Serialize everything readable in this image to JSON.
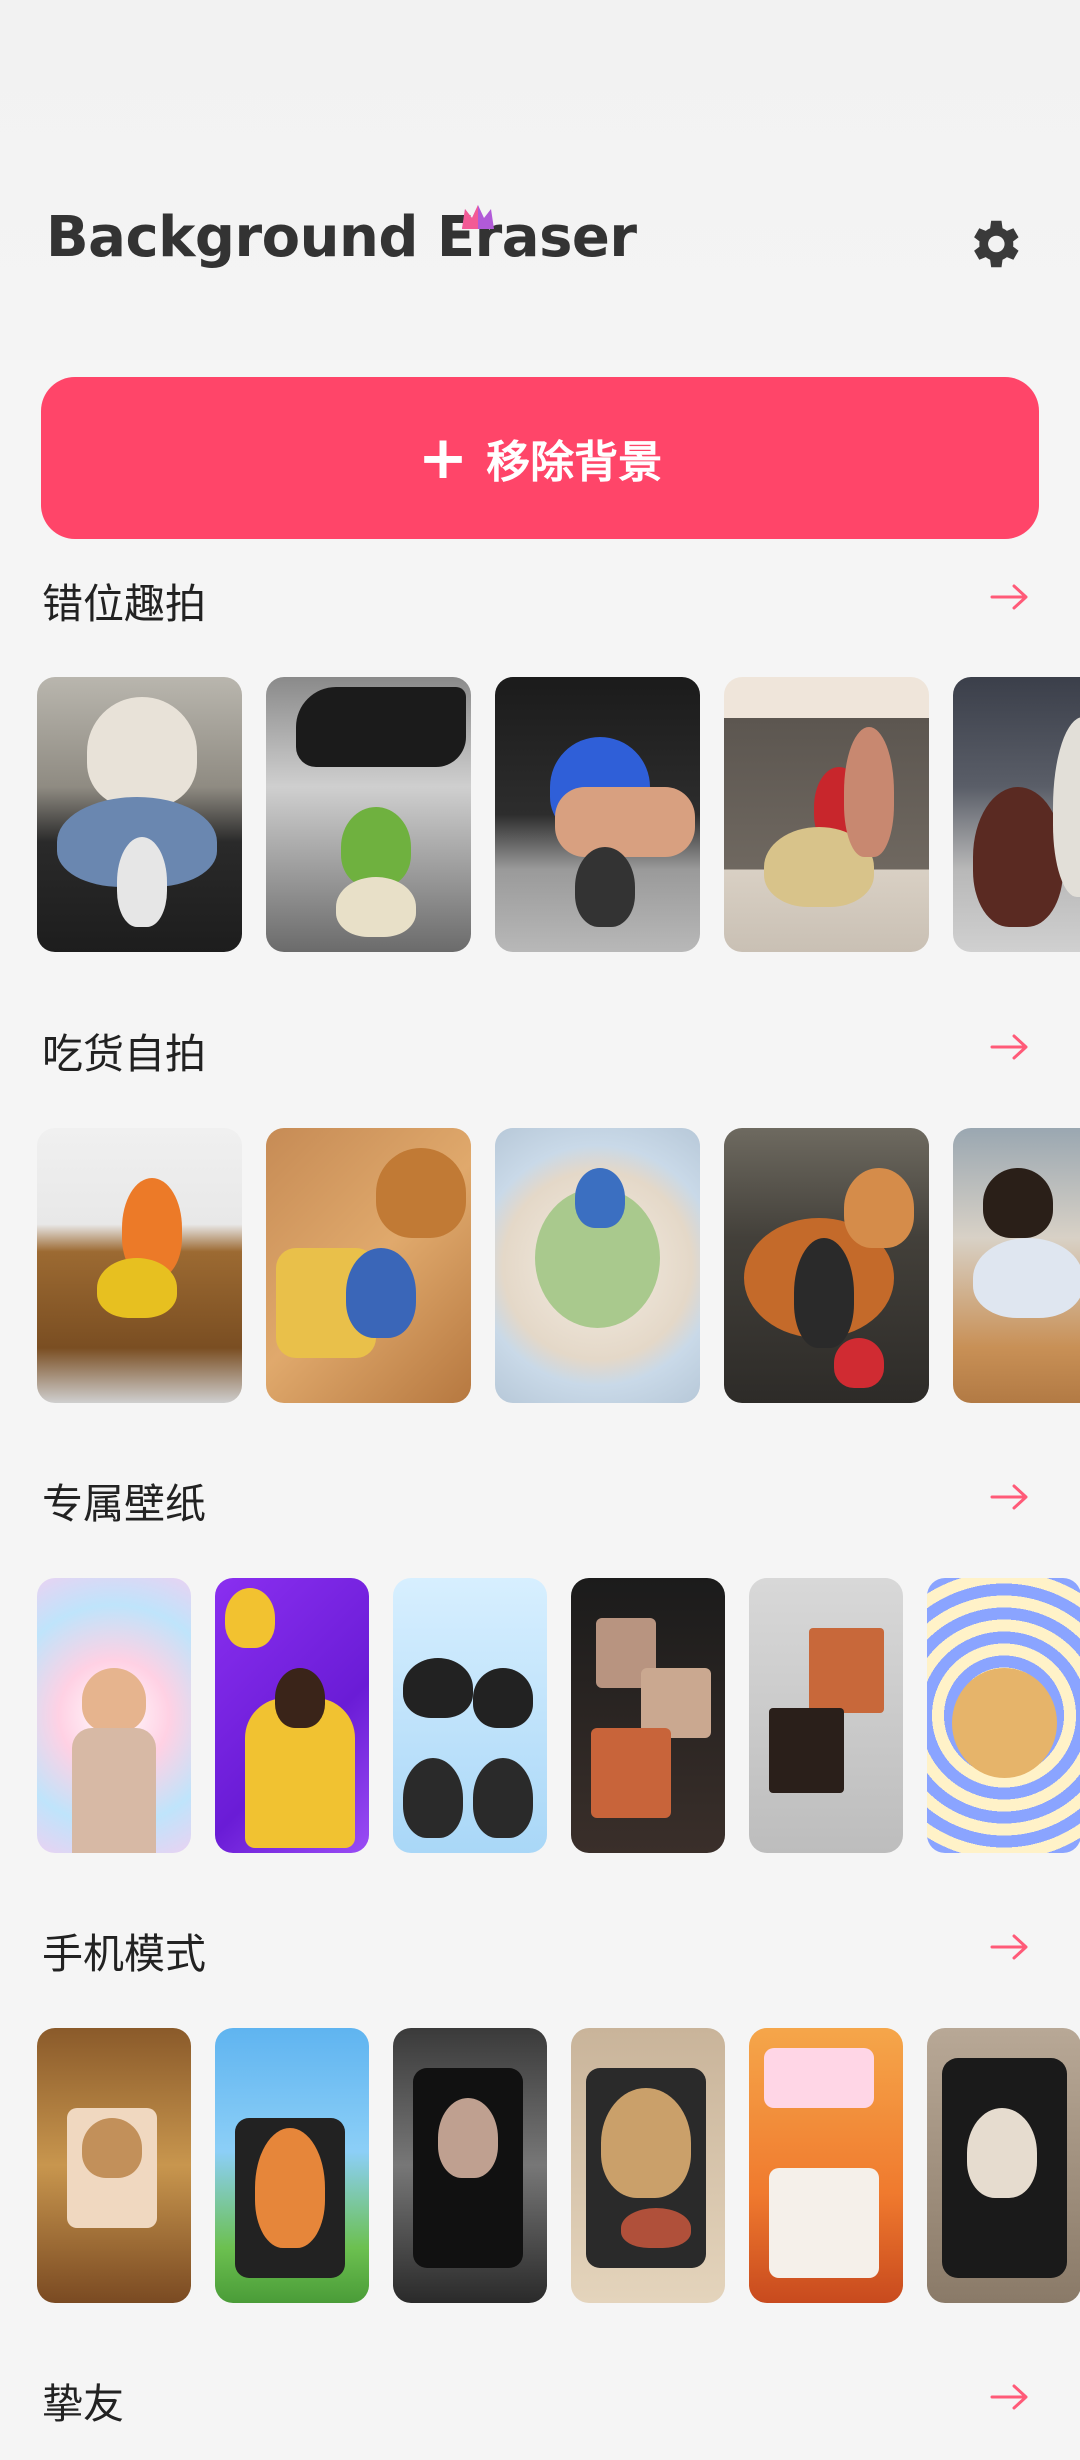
{
  "header": {
    "logo_text": "Background Eraser",
    "settings_icon": "gear-icon"
  },
  "cta": {
    "label": "移除背景",
    "icon": "plus-icon"
  },
  "sections": [
    {
      "title": "错位趣拍",
      "arrow_icon": "arrow-right-icon"
    },
    {
      "title": "吃货自拍",
      "arrow_icon": "arrow-right-icon"
    },
    {
      "title": "专属壁纸",
      "arrow_icon": "arrow-right-icon"
    },
    {
      "title": "手机模式",
      "arrow_icon": "arrow-right-icon"
    },
    {
      "title": "挚友",
      "arrow_icon": "arrow-right-icon"
    }
  ],
  "colors": {
    "accent": "#ff4569",
    "arrow": "#ff5a78",
    "background": "#f5f5f5",
    "text": "#222222"
  }
}
